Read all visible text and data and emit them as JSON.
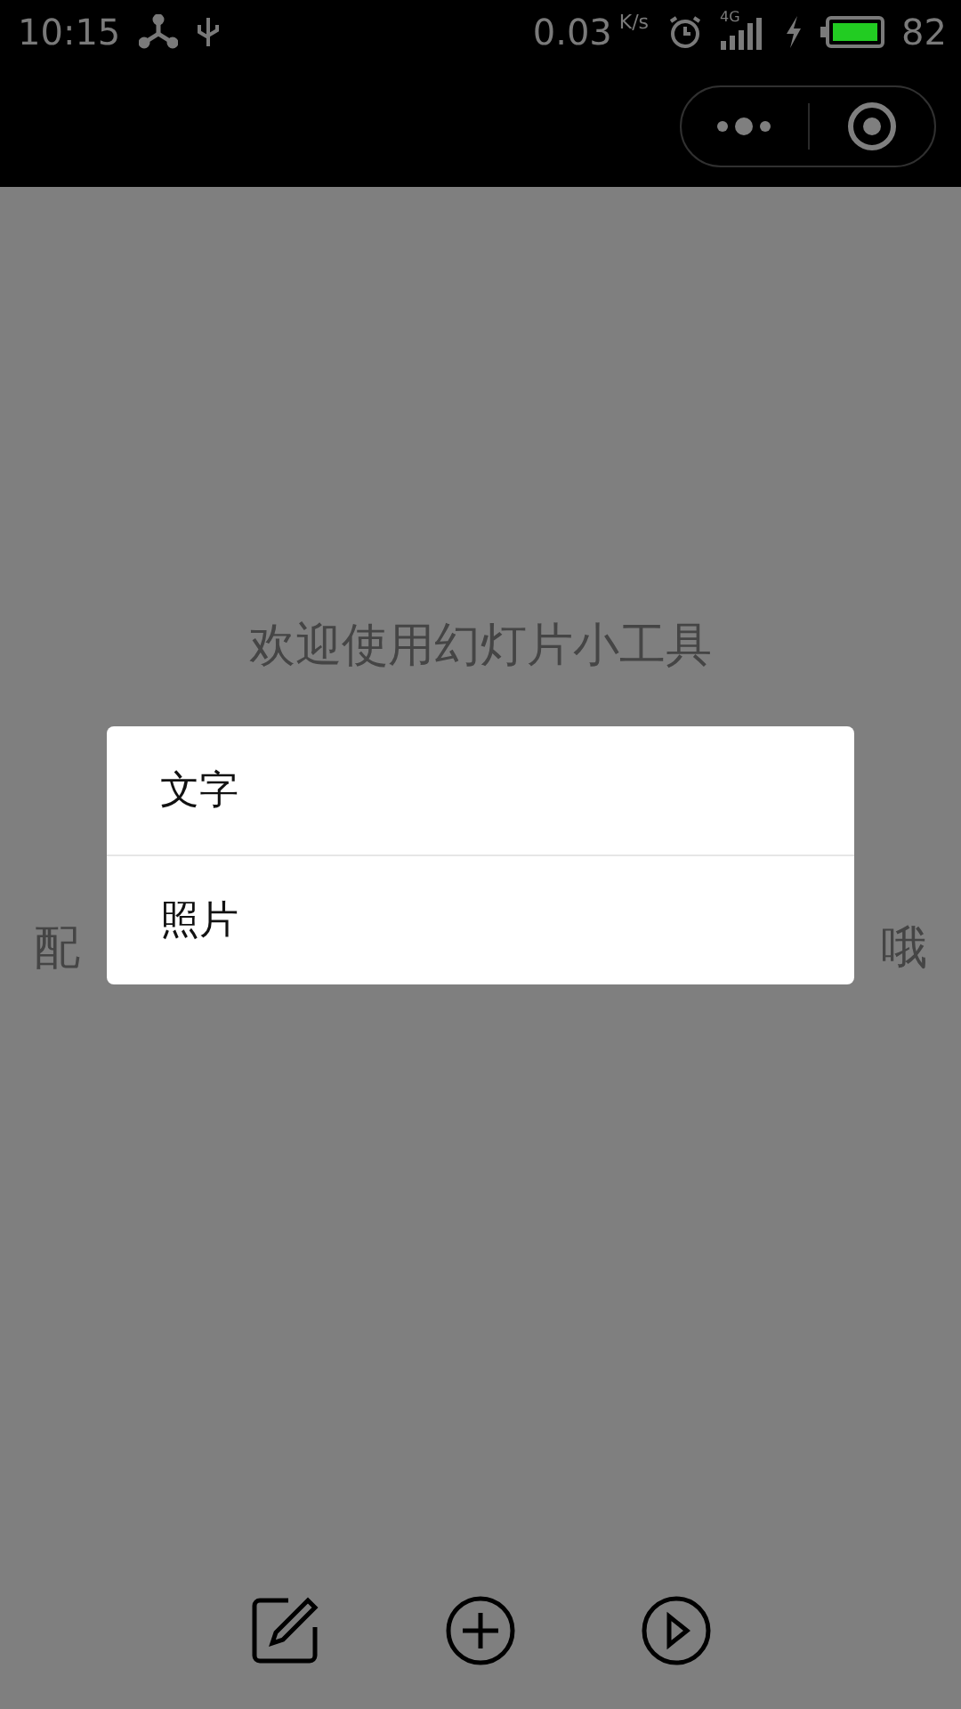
{
  "status_bar": {
    "time": "10:15",
    "speed": "0.03",
    "speed_unit": "K/s",
    "network": "4G",
    "battery": "82"
  },
  "page": {
    "lines": [
      {
        "kind": "line",
        "text": "欢迎使用幻灯片小工具"
      },
      {
        "kind": "split",
        "parts": [
          "配",
          "哦"
        ]
      }
    ]
  },
  "action_sheet": {
    "items": [
      {
        "label": "文字"
      },
      {
        "label": "照片"
      }
    ]
  }
}
